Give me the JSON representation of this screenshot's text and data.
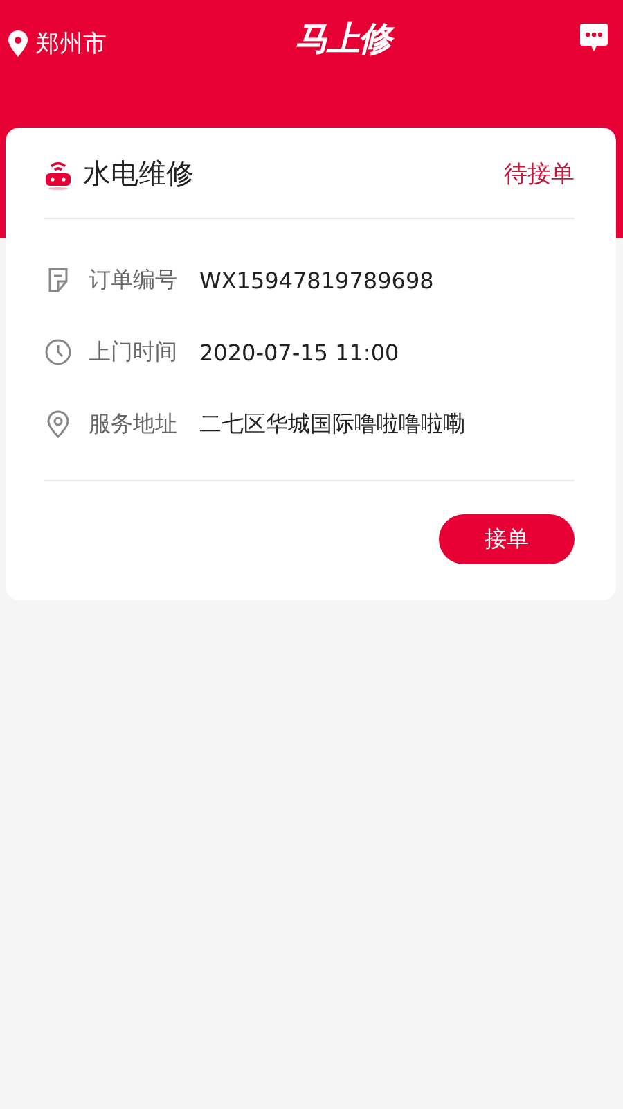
{
  "header": {
    "city": "郑州市",
    "logo": "马上修"
  },
  "order": {
    "title": "水电维修",
    "status": "待接单",
    "fields": [
      {
        "kind": "order",
        "label": "订单编号",
        "value": "WX15947819789698"
      },
      {
        "kind": "time",
        "label": "上门时间",
        "value": "2020-07-15 11:00"
      },
      {
        "kind": "address",
        "label": "服务地址",
        "value": "二七区华城国际噜啦噜啦嘞"
      }
    ],
    "button": "接单"
  }
}
